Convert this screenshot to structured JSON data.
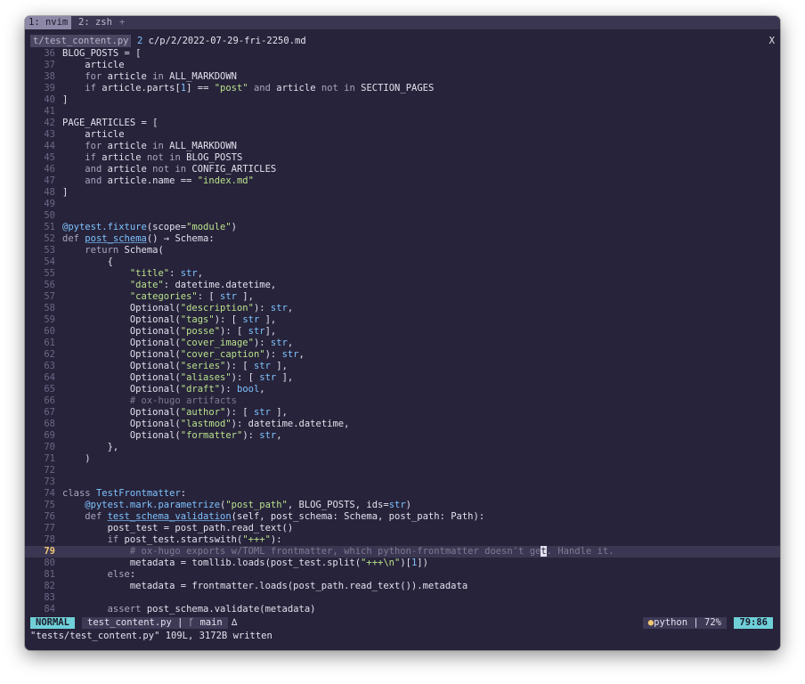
{
  "tmux": {
    "tabs": [
      {
        "label": "1: nvim"
      },
      {
        "label": "2: zsh"
      }
    ],
    "plus": "+"
  },
  "buffers": {
    "tab1": "t/test_content.py",
    "tab2_num": "2",
    "tab2_label": "c/p/2/2022-07-29-fri-2250.md",
    "close": "X"
  },
  "lines": [
    {
      "n": "36",
      "html": "BLOG_POSTS = ["
    },
    {
      "n": "37",
      "html": "    article"
    },
    {
      "n": "38",
      "html": "    <span class=\"kw\">for</span> article <span class=\"kw\">in</span> ALL_MARKDOWN"
    },
    {
      "n": "39",
      "html": "    <span class=\"kw\">if</span> article.parts[<span class=\"tp\">1</span>] == <span class=\"str\">\"post\"</span> <span class=\"kw\">and</span> article <span class=\"kw\">not in</span> SECTION_PAGES"
    },
    {
      "n": "40",
      "html": "]"
    },
    {
      "n": "41",
      "html": ""
    },
    {
      "n": "42",
      "html": "PAGE_ARTICLES = ["
    },
    {
      "n": "43",
      "html": "    article"
    },
    {
      "n": "44",
      "html": "    <span class=\"kw\">for</span> article <span class=\"kw\">in</span> ALL_MARKDOWN"
    },
    {
      "n": "45",
      "html": "    <span class=\"kw\">if</span> article <span class=\"kw\">not in</span> BLOG_POSTS"
    },
    {
      "n": "46",
      "html": "    <span class=\"kw\">and</span> article <span class=\"kw\">not in</span> CONFIG_ARTICLES"
    },
    {
      "n": "47",
      "html": "    <span class=\"kw\">and</span> article.name == <span class=\"str\">\"index.md\"</span>"
    },
    {
      "n": "48",
      "html": "]"
    },
    {
      "n": "49",
      "html": ""
    },
    {
      "n": "50",
      "html": ""
    },
    {
      "n": "51",
      "html": "<span class=\"dec\">@pytest.fixture</span>(scope=<span class=\"str\">\"module\"</span>)"
    },
    {
      "n": "52",
      "html": "<span class=\"kw\">def</span> <span class=\"fn\">post_schema</span>() → Schema:"
    },
    {
      "n": "53",
      "html": "    <span class=\"kw\">return</span> Schema("
    },
    {
      "n": "54",
      "html": "        {"
    },
    {
      "n": "55",
      "html": "            <span class=\"str\">\"title\"</span>: <span class=\"tp\">str</span>,"
    },
    {
      "n": "56",
      "html": "            <span class=\"str\">\"date\"</span>: datetime.datetime,"
    },
    {
      "n": "57",
      "html": "            <span class=\"str\">\"categories\"</span>: [ <span class=\"tp\">str</span> ],"
    },
    {
      "n": "58",
      "html": "            Optional(<span class=\"str\">\"description\"</span>): <span class=\"tp\">str</span>,"
    },
    {
      "n": "59",
      "html": "            Optional(<span class=\"str\">\"tags\"</span>): [ <span class=\"tp\">str</span> ],"
    },
    {
      "n": "60",
      "html": "            Optional(<span class=\"str\">\"posse\"</span>): [ <span class=\"tp\">str</span>],"
    },
    {
      "n": "61",
      "html": "            Optional(<span class=\"str\">\"cover_image\"</span>): <span class=\"tp\">str</span>,"
    },
    {
      "n": "62",
      "html": "            Optional(<span class=\"str\">\"cover_caption\"</span>): <span class=\"tp\">str</span>,"
    },
    {
      "n": "63",
      "html": "            Optional(<span class=\"str\">\"series\"</span>): [ <span class=\"tp\">str</span> ],"
    },
    {
      "n": "64",
      "html": "            Optional(<span class=\"str\">\"aliases\"</span>): [ <span class=\"tp\">str</span> ],"
    },
    {
      "n": "65",
      "html": "            Optional(<span class=\"str\">\"draft\"</span>): <span class=\"tp\">bool</span>,"
    },
    {
      "n": "66",
      "html": "            <span class=\"cm\"># ox-hugo artifacts</span>"
    },
    {
      "n": "67",
      "html": "            Optional(<span class=\"str\">\"author\"</span>): [ <span class=\"tp\">str</span> ],"
    },
    {
      "n": "68",
      "html": "            Optional(<span class=\"str\">\"lastmod\"</span>): datetime.datetime,"
    },
    {
      "n": "69",
      "html": "            Optional(<span class=\"str\">\"formatter\"</span>): <span class=\"tp\">str</span>,"
    },
    {
      "n": "70",
      "html": "        },"
    },
    {
      "n": "71",
      "html": "    )"
    },
    {
      "n": "72",
      "html": ""
    },
    {
      "n": "73",
      "html": ""
    },
    {
      "n": "74",
      "html": "<span class=\"kw\">class</span> <span class=\"tp\">TestFrontmatter</span>:"
    },
    {
      "n": "75",
      "html": "    <span class=\"dec\">@pytest.mark.parametrize</span>(<span class=\"str\">\"post_path\"</span>, BLOG_POSTS, ids=<span class=\"tp\">str</span>)"
    },
    {
      "n": "76",
      "html": "    <span class=\"kw\">def</span> <span class=\"fn\">test_schema_validation</span>(self, post_schema: Schema, post_path: Path):"
    },
    {
      "n": "77",
      "html": "        post_test = post_path.read_text()"
    },
    {
      "n": "78",
      "html": "        <span class=\"kw\">if</span> post_test.startswith(<span class=\"str\">\"+++\"</span>):"
    },
    {
      "n": "79",
      "cursor": true,
      "html": "            <span class=\"cm\"># ox-hugo exports w/TOML frontmatter, which python-frontmatter doesn't ge<span class=\"cur\">t</span>. Handle it.</span>"
    },
    {
      "n": "80",
      "html": "            metadata = tomllib.loads(post_test.split(<span class=\"str\">\"+++\\n\"</span>)[<span class=\"tp\">1</span>])"
    },
    {
      "n": "81",
      "html": "        <span class=\"kw\">else</span>:"
    },
    {
      "n": "82",
      "html": "            metadata = frontmatter.loads(post_path.read_text()).metadata"
    },
    {
      "n": "83",
      "html": ""
    },
    {
      "n": "84",
      "html": "        <span class=\"kw\">assert</span> post_schema.validate(metadata)"
    }
  ],
  "status": {
    "mode": "NORMAL",
    "file": "test_content.py",
    "sep": " | ",
    "branch": "main",
    "filetype": "python",
    "percent": "72%",
    "position": "79:86"
  },
  "cmdline": "\"tests/test_content.py\" 109L, 3172B written"
}
